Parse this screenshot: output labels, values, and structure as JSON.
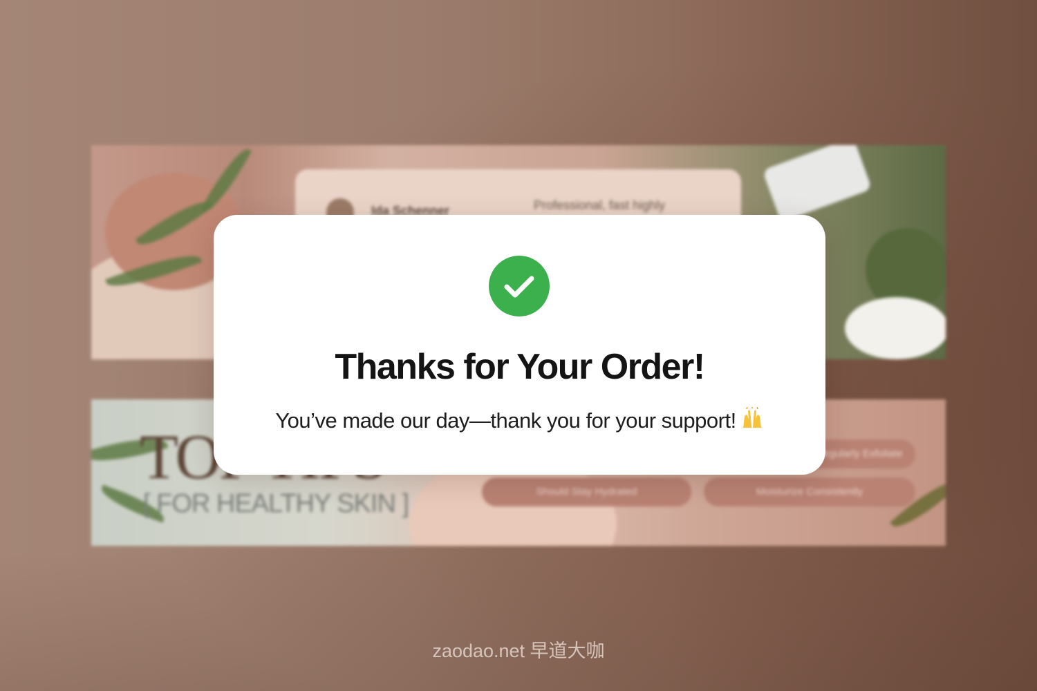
{
  "background": {
    "review_card": {
      "name": "Ida Schenner",
      "quote": "Professional, fast highly"
    },
    "tips_banner": {
      "title": "TOP TIPS",
      "subtitle": "[ FOR HEALTHY SKIN ]",
      "pills": [
        "Should Stay Hydrated",
        "Moisturize Consistently",
        "Regularly Exfoliate"
      ]
    }
  },
  "modal": {
    "icon": "check-circle-icon",
    "title": "Thanks for Your Order!",
    "message": "You’ve made our day—thank you for your support!",
    "emoji": "raising-hands-icon"
  },
  "watermark": "zaodao.net 早道大咖",
  "colors": {
    "success": "#3bb04c",
    "modal_bg": "#ffffff",
    "title_text": "#141414"
  }
}
